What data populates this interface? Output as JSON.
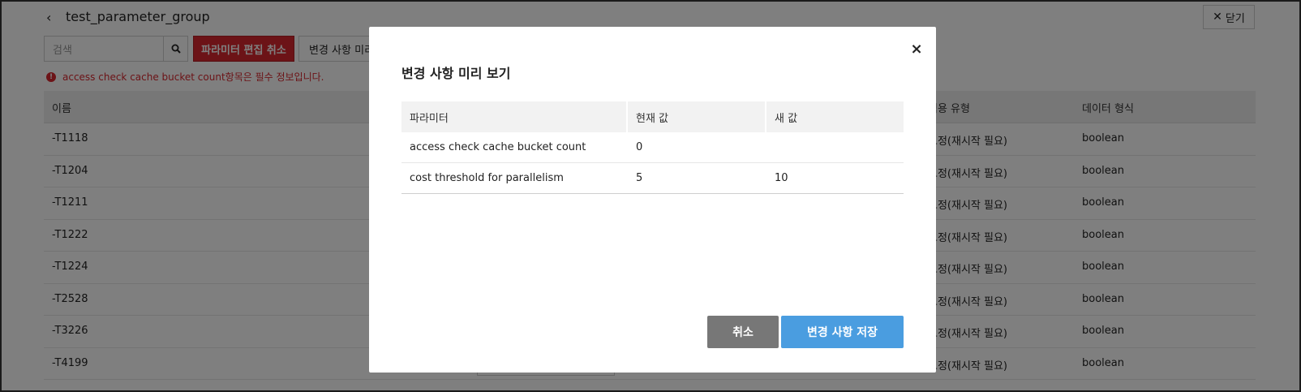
{
  "header": {
    "title": "test_parameter_group",
    "close_label": "닫기"
  },
  "toolbar": {
    "search_placeholder": "검색",
    "cancel_edit_label": "파라미터 편집 취소",
    "preview_label": "변경 사항 미리"
  },
  "error_message": "access check cache bucket count항목은 필수 정보입니다.",
  "table": {
    "headers": {
      "name": "이름",
      "apply_type": "적용 유형",
      "data_type": "데이터 형식"
    },
    "rows": [
      {
        "name": "-T1118",
        "apply_type": "고정(재시작 필요)",
        "data_type": "boolean"
      },
      {
        "name": "-T1204",
        "apply_type": "고정(재시작 필요)",
        "data_type": "boolean"
      },
      {
        "name": "-T1211",
        "apply_type": "고정(재시작 필요)",
        "data_type": "boolean"
      },
      {
        "name": "-T1222",
        "apply_type": "고정(재시작 필요)",
        "data_type": "boolean"
      },
      {
        "name": "-T1224",
        "apply_type": "고정(재시작 필요)",
        "data_type": "boolean"
      },
      {
        "name": "-T2528",
        "apply_type": "고정(재시작 필요)",
        "data_type": "boolean"
      },
      {
        "name": "-T3226",
        "apply_type": "고정(재시작 필요)",
        "data_type": "boolean"
      },
      {
        "name": "-T4199",
        "apply_type": "고정(재시작 필요)",
        "data_type": "boolean"
      }
    ]
  },
  "modal": {
    "title": "변경 사항 미리 보기",
    "headers": {
      "param": "파라미터",
      "current": "현재 값",
      "new": "새 값"
    },
    "rows": [
      {
        "param": "access check cache bucket count",
        "current": "0",
        "new": ""
      },
      {
        "param": "cost threshold for parallelism",
        "current": "5",
        "new": "10"
      }
    ],
    "cancel_label": "취소",
    "save_label": "변경 사항 저장"
  }
}
